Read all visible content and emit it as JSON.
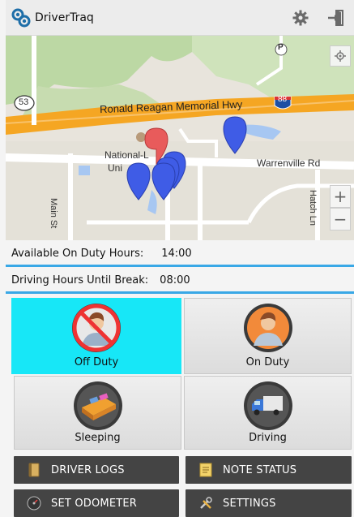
{
  "app": {
    "title": "DriverTraq"
  },
  "map": {
    "highway_shield_53": "53",
    "highway_shield_88": "88",
    "parking_letter": "P",
    "road_hwy": "Ronald Reagan Memorial Hwy",
    "road_warrenville": "Warrenville Rd",
    "place_label_1": "National-L",
    "place_label_2": "Uni",
    "road_main": "Main St",
    "road_hatch": "Hatch Ln",
    "zoom_in": "+",
    "zoom_out": "−"
  },
  "hours": {
    "on_duty_label": "Available On Duty Hours:",
    "on_duty_value": "14:00",
    "break_label": "Driving Hours Until Break:",
    "break_value": "08:00"
  },
  "status": {
    "off_duty": "Off Duty",
    "on_duty": "On Duty",
    "sleeping": "Sleeping",
    "driving": "Driving"
  },
  "menu": {
    "driver_logs": "DRIVER LOGS",
    "note_status": "NOTE STATUS",
    "set_odometer": "SET ODOMETER",
    "settings": "SETTINGS"
  },
  "colors": {
    "active_status": "#17e7f7",
    "accent_line": "#39a8e6",
    "menu_bg": "#444444",
    "highway": "#f5a623",
    "marker_blue": "#3f5ce6",
    "marker_red": "#e85b5b"
  }
}
